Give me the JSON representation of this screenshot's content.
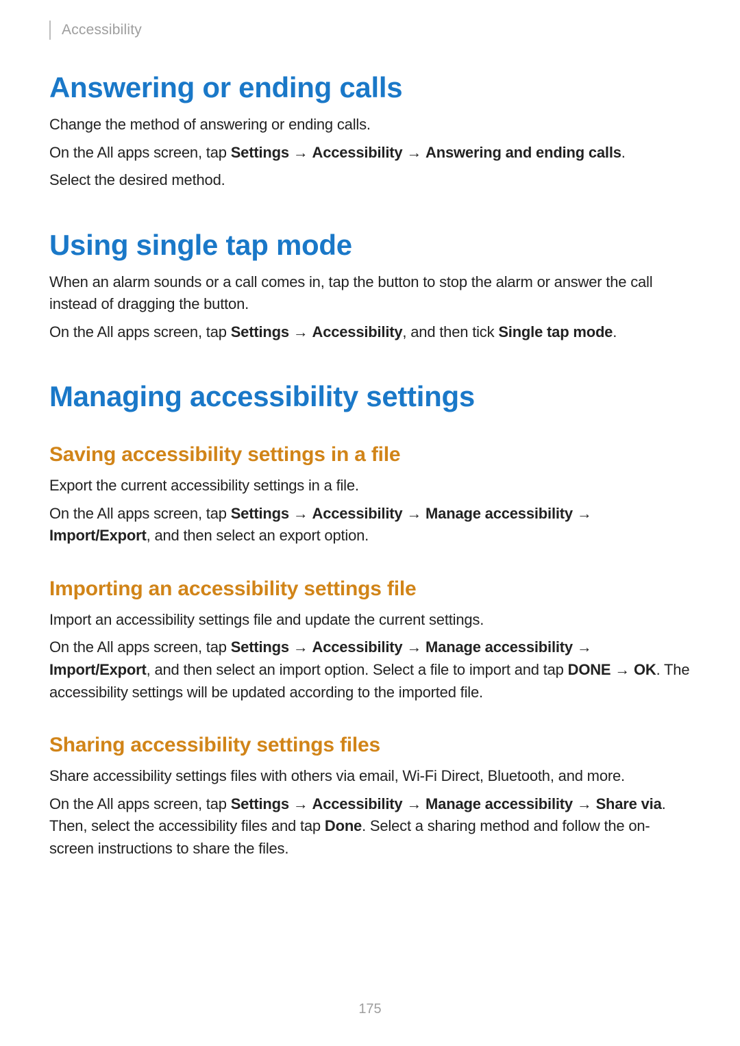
{
  "header": {
    "breadcrumb": "Accessibility"
  },
  "s1": {
    "title": "Answering or ending calls",
    "p1": "Change the method of answering or ending calls.",
    "p2a": "On the All apps screen, tap ",
    "p2b": "Settings",
    "p2c": " → ",
    "p2d": "Accessibility",
    "p2e": " → ",
    "p2f": "Answering and ending calls",
    "p2g": ".",
    "p3": "Select the desired method."
  },
  "s2": {
    "title": "Using single tap mode",
    "p1": "When an alarm sounds or a call comes in, tap the button to stop the alarm or answer the call instead of dragging the button.",
    "p2a": "On the All apps screen, tap ",
    "p2b": "Settings",
    "p2c": " → ",
    "p2d": "Accessibility",
    "p2e": ", and then tick ",
    "p2f": "Single tap mode",
    "p2g": "."
  },
  "s3": {
    "title": "Managing accessibility settings",
    "sub1": {
      "title": "Saving accessibility settings in a file",
      "p1": "Export the current accessibility settings in a file.",
      "p2a": "On the All apps screen, tap ",
      "p2b": "Settings",
      "p2c": " → ",
      "p2d": "Accessibility",
      "p2e": " → ",
      "p2f": "Manage accessibility",
      "p2g": " → ",
      "p2h": "Import/Export",
      "p2i": ", and then select an export option."
    },
    "sub2": {
      "title": "Importing an accessibility settings file",
      "p1": "Import an accessibility settings file and update the current settings.",
      "p2a": "On the All apps screen, tap ",
      "p2b": "Settings",
      "p2c": " → ",
      "p2d": "Accessibility",
      "p2e": " → ",
      "p2f": "Manage accessibility",
      "p2g": " → ",
      "p2h": "Import/Export",
      "p2i": ", and then select an import option. Select a file to import and tap ",
      "p2j": "DONE",
      "p2k": " → ",
      "p2l": "OK",
      "p2m": ". The accessibility settings will be updated according to the imported file."
    },
    "sub3": {
      "title": "Sharing accessibility settings files",
      "p1": "Share accessibility settings files with others via email, Wi-Fi Direct, Bluetooth, and more.",
      "p2a": "On the All apps screen, tap ",
      "p2b": "Settings",
      "p2c": " → ",
      "p2d": "Accessibility",
      "p2e": " → ",
      "p2f": "Manage accessibility",
      "p2g": " → ",
      "p2h": "Share via",
      "p2i": ". Then, select the accessibility files and tap ",
      "p2j": "Done",
      "p2k": ". Select a sharing method and follow the on-screen instructions to share the files."
    }
  },
  "page_number": "175"
}
